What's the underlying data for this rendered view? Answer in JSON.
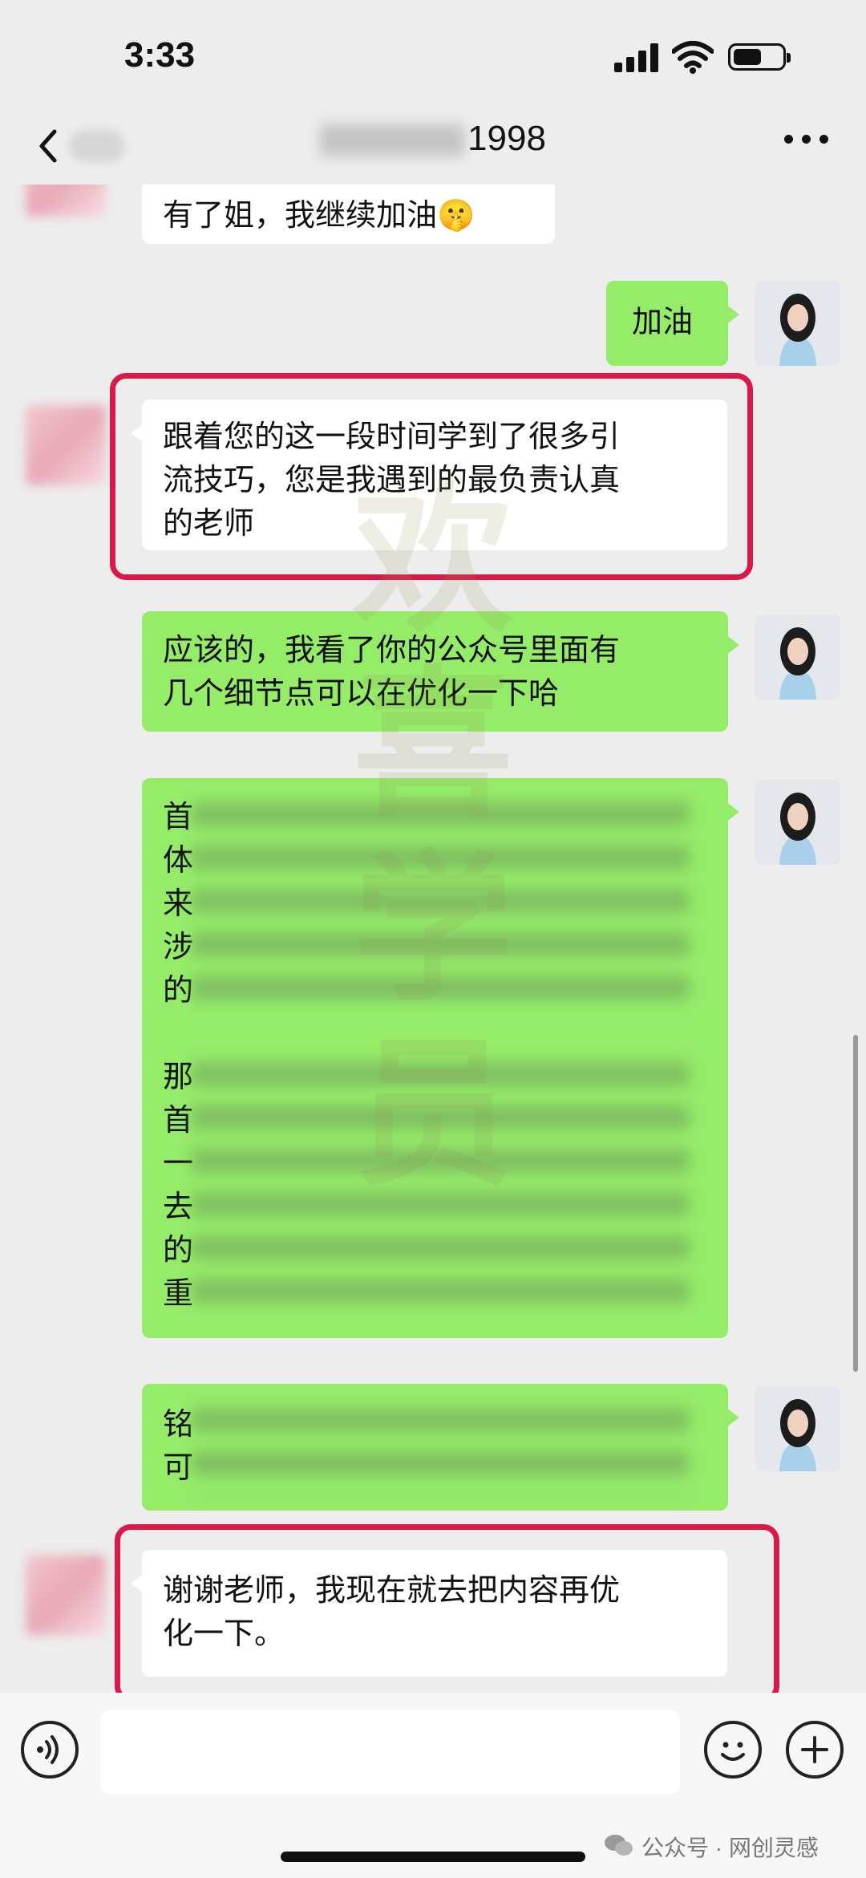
{
  "status_bar": {
    "time": "3:33"
  },
  "header": {
    "title_suffix": "1998"
  },
  "messages": {
    "m1": {
      "text": "有了姐，我继续加油🤫",
      "sender": "contact"
    },
    "m2": {
      "text": "加油",
      "sender": "self"
    },
    "m3": {
      "line1": "跟着您的这一段时间学到了很多引",
      "line2": "流技巧，您是我遇到的最负责认真",
      "line3": "的老师",
      "sender": "contact"
    },
    "m4": {
      "line1": "应该的，我看了你的公众号里面有",
      "line2": "几个细节点可以在优化一下哈",
      "sender": "self"
    },
    "m5": {
      "line1": "首",
      "line2": "体",
      "line3": "来",
      "line4": "涉",
      "line5": "的",
      "line7": "那",
      "line8": "首",
      "line9": "一",
      "line10": "去",
      "line11": "的",
      "line12": "重",
      "sender": "self"
    },
    "m6": {
      "line1": "铭",
      "line2": "可",
      "sender": "self"
    },
    "m7": {
      "line1": "谢谢老师，我现在就去把内容再优",
      "line2": "化一下。",
      "sender": "contact"
    }
  },
  "watermark": {
    "chars": [
      "欢",
      "喜",
      "学",
      "员"
    ]
  },
  "footer": {
    "source": "公众号 · 网创灵感"
  },
  "colors": {
    "self_bubble": "#95ec69",
    "contact_bubble": "#ffffff",
    "highlight": "#d8194a",
    "background": "#ededed"
  },
  "icons": [
    "back-icon",
    "more-icon",
    "voice-icon",
    "emoji-icon",
    "plus-icon",
    "wechat-icon",
    "signal-icon",
    "wifi-icon",
    "battery-icon"
  ]
}
